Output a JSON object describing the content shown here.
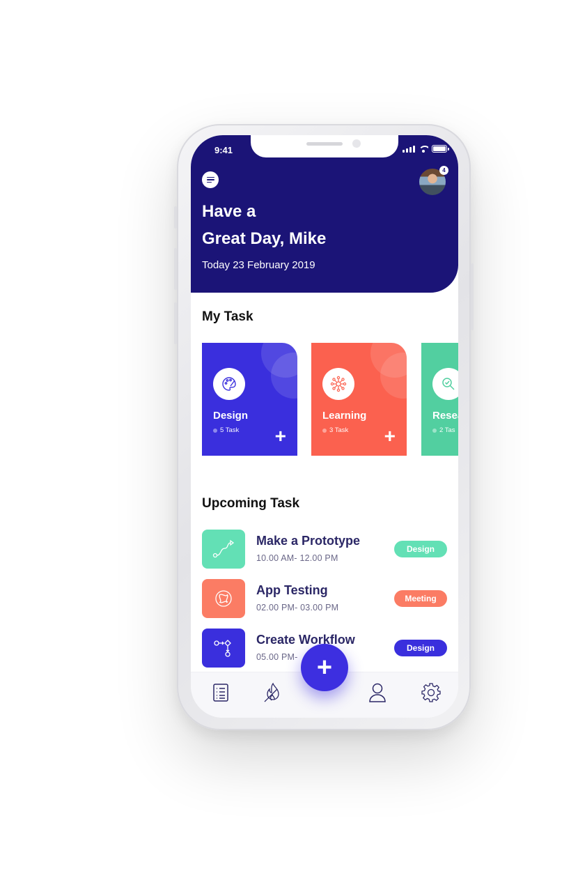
{
  "status_bar": {
    "time": "9:41"
  },
  "header": {
    "greeting_line1": "Have a",
    "greeting_line2": "Great Day, Mike",
    "date": "Today 23 February 2019",
    "notification_count": "4",
    "menu_icon": "menu-icon",
    "avatar": "user-avatar"
  },
  "my_task": {
    "title": "My Task",
    "cards": [
      {
        "name": "Design",
        "count": "5 Task",
        "color": "#3a2fdd",
        "icon": "palette-icon"
      },
      {
        "name": "Learning",
        "count": "3 Task",
        "color": "#fb614f",
        "icon": "network-icon"
      },
      {
        "name": "Resea",
        "count": "2 Tas",
        "color": "#52cfa0",
        "icon": "search-check-icon"
      }
    ]
  },
  "upcoming": {
    "title": "Upcoming Task",
    "tasks": [
      {
        "name": "Make a Prototype",
        "time": "10.00 AM- 12.00 PM",
        "tag": "Design",
        "tag_color": "#63e0b5",
        "icon_color": "#63e0b5",
        "icon": "prototype-path-icon"
      },
      {
        "name": "App Testing",
        "time": "02.00 PM- 03.00 PM",
        "tag": "Meeting",
        "tag_color": "#fb7c64",
        "icon_color": "#fb7c64",
        "icon": "knot-icon"
      },
      {
        "name": "Create Workflow",
        "time": "05.00 PM-",
        "tag": "Design",
        "tag_color": "#3a2fdd",
        "icon_color": "#3a2fdd",
        "icon": "workflow-icon"
      }
    ]
  },
  "nav": {
    "items": [
      "tasks-list-icon",
      "flame-icon",
      "profile-icon",
      "settings-icon"
    ],
    "fab_label": "+"
  },
  "colors": {
    "header_bg": "#1b1477",
    "accent": "#3d2fe0",
    "text_dark": "#2b2766"
  }
}
